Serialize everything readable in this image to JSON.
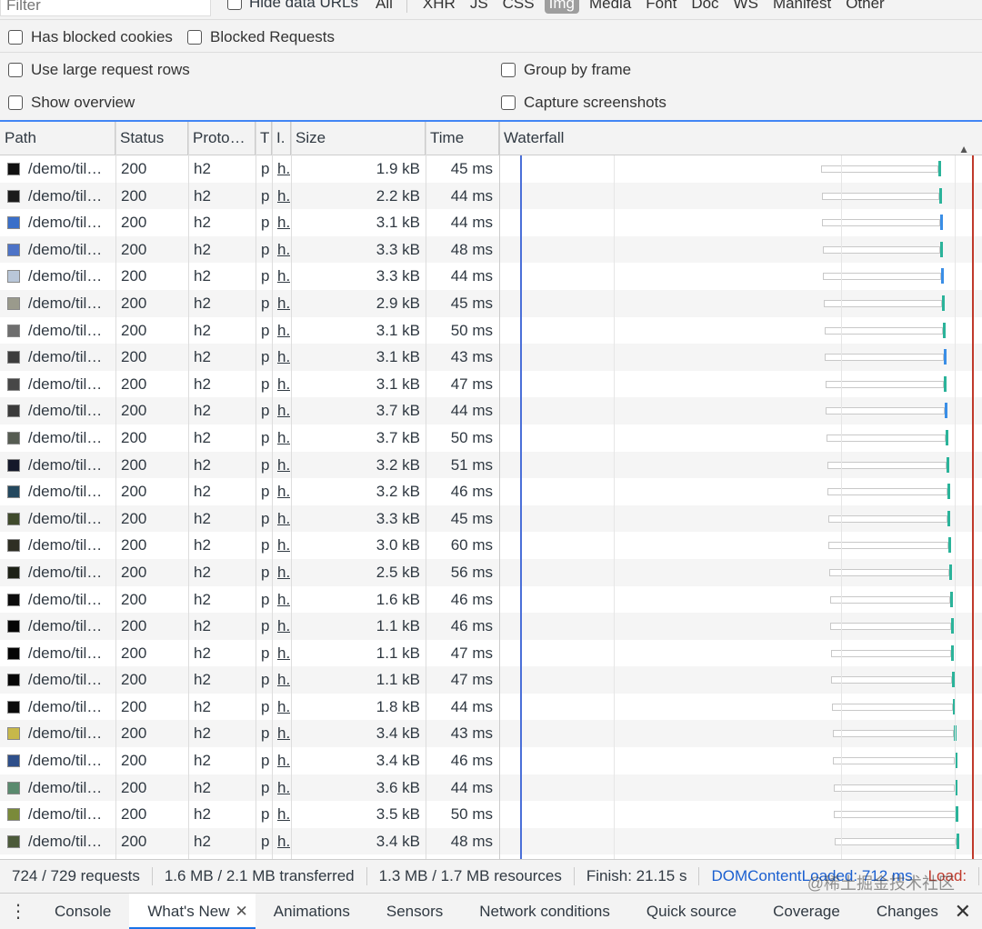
{
  "filter": {
    "placeholder": "Filter"
  },
  "hide_data_urls": "Hide data URLs",
  "type_filters": [
    "All",
    "XHR",
    "JS",
    "CSS",
    "Img",
    "Media",
    "Font",
    "Doc",
    "WS",
    "Manifest",
    "Other"
  ],
  "active_type": "Img",
  "options": {
    "has_blocked_cookies": "Has blocked cookies",
    "blocked_requests": "Blocked Requests",
    "use_large_rows": "Use large request rows",
    "group_by_frame": "Group by frame",
    "show_overview": "Show overview",
    "capture_screenshots": "Capture screenshots"
  },
  "columns": {
    "path": "Path",
    "status": "Status",
    "protocol": "Proto…",
    "type": "T",
    "initiator": "I.",
    "size": "Size",
    "time": "Time",
    "waterfall": "Waterfall"
  },
  "rows": [
    {
      "path": "/demo/til…",
      "status": "200",
      "proto": "h2",
      "type": "p",
      "init": "h.",
      "size": "1.9 kB",
      "time": "45 ms",
      "thumb": "#111111",
      "tip": "#2bb39a"
    },
    {
      "path": "/demo/til…",
      "status": "200",
      "proto": "h2",
      "type": "p",
      "init": "h.",
      "size": "2.2 kB",
      "time": "44 ms",
      "thumb": "#1b1b1b",
      "tip": "#2bb39a"
    },
    {
      "path": "/demo/til…",
      "status": "200",
      "proto": "h2",
      "type": "p",
      "init": "h.",
      "size": "3.1 kB",
      "time": "44 ms",
      "thumb": "#3a6fc9",
      "tip": "#3a8ee6"
    },
    {
      "path": "/demo/til…",
      "status": "200",
      "proto": "h2",
      "type": "p",
      "init": "h.",
      "size": "3.3 kB",
      "time": "48 ms",
      "thumb": "#4d73c7",
      "tip": "#2bb39a"
    },
    {
      "path": "/demo/til…",
      "status": "200",
      "proto": "h2",
      "type": "p",
      "init": "h.",
      "size": "3.3 kB",
      "time": "44 ms",
      "thumb": "#b9c7d9",
      "tip": "#3a8ee6"
    },
    {
      "path": "/demo/til…",
      "status": "200",
      "proto": "h2",
      "type": "p",
      "init": "h.",
      "size": "2.9 kB",
      "time": "45 ms",
      "thumb": "#9a9a8c",
      "tip": "#2bb39a"
    },
    {
      "path": "/demo/til…",
      "status": "200",
      "proto": "h2",
      "type": "p",
      "init": "h.",
      "size": "3.1 kB",
      "time": "50 ms",
      "thumb": "#6e6e6e",
      "tip": "#2bb39a"
    },
    {
      "path": "/demo/til…",
      "status": "200",
      "proto": "h2",
      "type": "p",
      "init": "h.",
      "size": "3.1 kB",
      "time": "43 ms",
      "thumb": "#3d3d3d",
      "tip": "#3a8ee6"
    },
    {
      "path": "/demo/til…",
      "status": "200",
      "proto": "h2",
      "type": "p",
      "init": "h.",
      "size": "3.1 kB",
      "time": "47 ms",
      "thumb": "#474747",
      "tip": "#2bb39a"
    },
    {
      "path": "/demo/til…",
      "status": "200",
      "proto": "h2",
      "type": "p",
      "init": "h.",
      "size": "3.7 kB",
      "time": "44 ms",
      "thumb": "#3a3a3a",
      "tip": "#3a8ee6"
    },
    {
      "path": "/demo/til…",
      "status": "200",
      "proto": "h2",
      "type": "p",
      "init": "h.",
      "size": "3.7 kB",
      "time": "50 ms",
      "thumb": "#565c52",
      "tip": "#2bb39a"
    },
    {
      "path": "/demo/til…",
      "status": "200",
      "proto": "h2",
      "type": "p",
      "init": "h.",
      "size": "3.2 kB",
      "time": "51 ms",
      "thumb": "#15192a",
      "tip": "#2bb39a"
    },
    {
      "path": "/demo/til…",
      "status": "200",
      "proto": "h2",
      "type": "p",
      "init": "h.",
      "size": "3.2 kB",
      "time": "46 ms",
      "thumb": "#24485e",
      "tip": "#2bb39a"
    },
    {
      "path": "/demo/til…",
      "status": "200",
      "proto": "h2",
      "type": "p",
      "init": "h.",
      "size": "3.3 kB",
      "time": "45 ms",
      "thumb": "#3f4a2c",
      "tip": "#2bb39a"
    },
    {
      "path": "/demo/til…",
      "status": "200",
      "proto": "h2",
      "type": "p",
      "init": "h.",
      "size": "3.0 kB",
      "time": "60 ms",
      "thumb": "#2f2f24",
      "tip": "#2bb39a"
    },
    {
      "path": "/demo/til…",
      "status": "200",
      "proto": "h2",
      "type": "p",
      "init": "h.",
      "size": "2.5 kB",
      "time": "56 ms",
      "thumb": "#1c2016",
      "tip": "#2bb39a"
    },
    {
      "path": "/demo/til…",
      "status": "200",
      "proto": "h2",
      "type": "p",
      "init": "h.",
      "size": "1.6 kB",
      "time": "46 ms",
      "thumb": "#0c0c0c",
      "tip": "#2bb39a"
    },
    {
      "path": "/demo/til…",
      "status": "200",
      "proto": "h2",
      "type": "p",
      "init": "h.",
      "size": "1.1 kB",
      "time": "46 ms",
      "thumb": "#050505",
      "tip": "#2bb39a"
    },
    {
      "path": "/demo/til…",
      "status": "200",
      "proto": "h2",
      "type": "p",
      "init": "h.",
      "size": "1.1 kB",
      "time": "47 ms",
      "thumb": "#050505",
      "tip": "#2bb39a"
    },
    {
      "path": "/demo/til…",
      "status": "200",
      "proto": "h2",
      "type": "p",
      "init": "h.",
      "size": "1.1 kB",
      "time": "47 ms",
      "thumb": "#050505",
      "tip": "#2bb39a"
    },
    {
      "path": "/demo/til…",
      "status": "200",
      "proto": "h2",
      "type": "p",
      "init": "h.",
      "size": "1.8 kB",
      "time": "44 ms",
      "thumb": "#0a0a0a",
      "tip": "#2bb39a"
    },
    {
      "path": "/demo/til…",
      "status": "200",
      "proto": "h2",
      "type": "p",
      "init": "h.",
      "size": "3.4 kB",
      "time": "43 ms",
      "thumb": "#c7b84a",
      "tip": "#2bb39a"
    },
    {
      "path": "/demo/til…",
      "status": "200",
      "proto": "h2",
      "type": "p",
      "init": "h.",
      "size": "3.4 kB",
      "time": "46 ms",
      "thumb": "#2e4f8a",
      "tip": "#2bb39a"
    },
    {
      "path": "/demo/til…",
      "status": "200",
      "proto": "h2",
      "type": "p",
      "init": "h.",
      "size": "3.6 kB",
      "time": "44 ms",
      "thumb": "#5a8a6e",
      "tip": "#2bb39a"
    },
    {
      "path": "/demo/til…",
      "status": "200",
      "proto": "h2",
      "type": "p",
      "init": "h.",
      "size": "3.5 kB",
      "time": "50 ms",
      "thumb": "#7a8a3a",
      "tip": "#2bb39a"
    },
    {
      "path": "/demo/til…",
      "status": "200",
      "proto": "h2",
      "type": "p",
      "init": "h.",
      "size": "3.4 kB",
      "time": "48 ms",
      "thumb": "#4c5a3a",
      "tip": "#2bb39a"
    }
  ],
  "summary": {
    "requests": "724 / 729 requests",
    "transferred": "1.6 MB / 2.1 MB transferred",
    "resources": "1.3 MB / 1.7 MB resources",
    "finish": "Finish: 21.15 s",
    "dom_content_loaded": "DOMContentLoaded: 712 ms",
    "load": "Load:"
  },
  "drawer_tabs": [
    "Console",
    "What's New",
    "Animations",
    "Sensors",
    "Network conditions",
    "Quick source",
    "Coverage",
    "Changes"
  ],
  "active_drawer_tab": "What's New",
  "watermark": "@稀土掘金技术社区",
  "colors": {
    "accent": "#1a73e8",
    "dom_line": "#4a6fd8",
    "load_line": "#c0392b"
  }
}
